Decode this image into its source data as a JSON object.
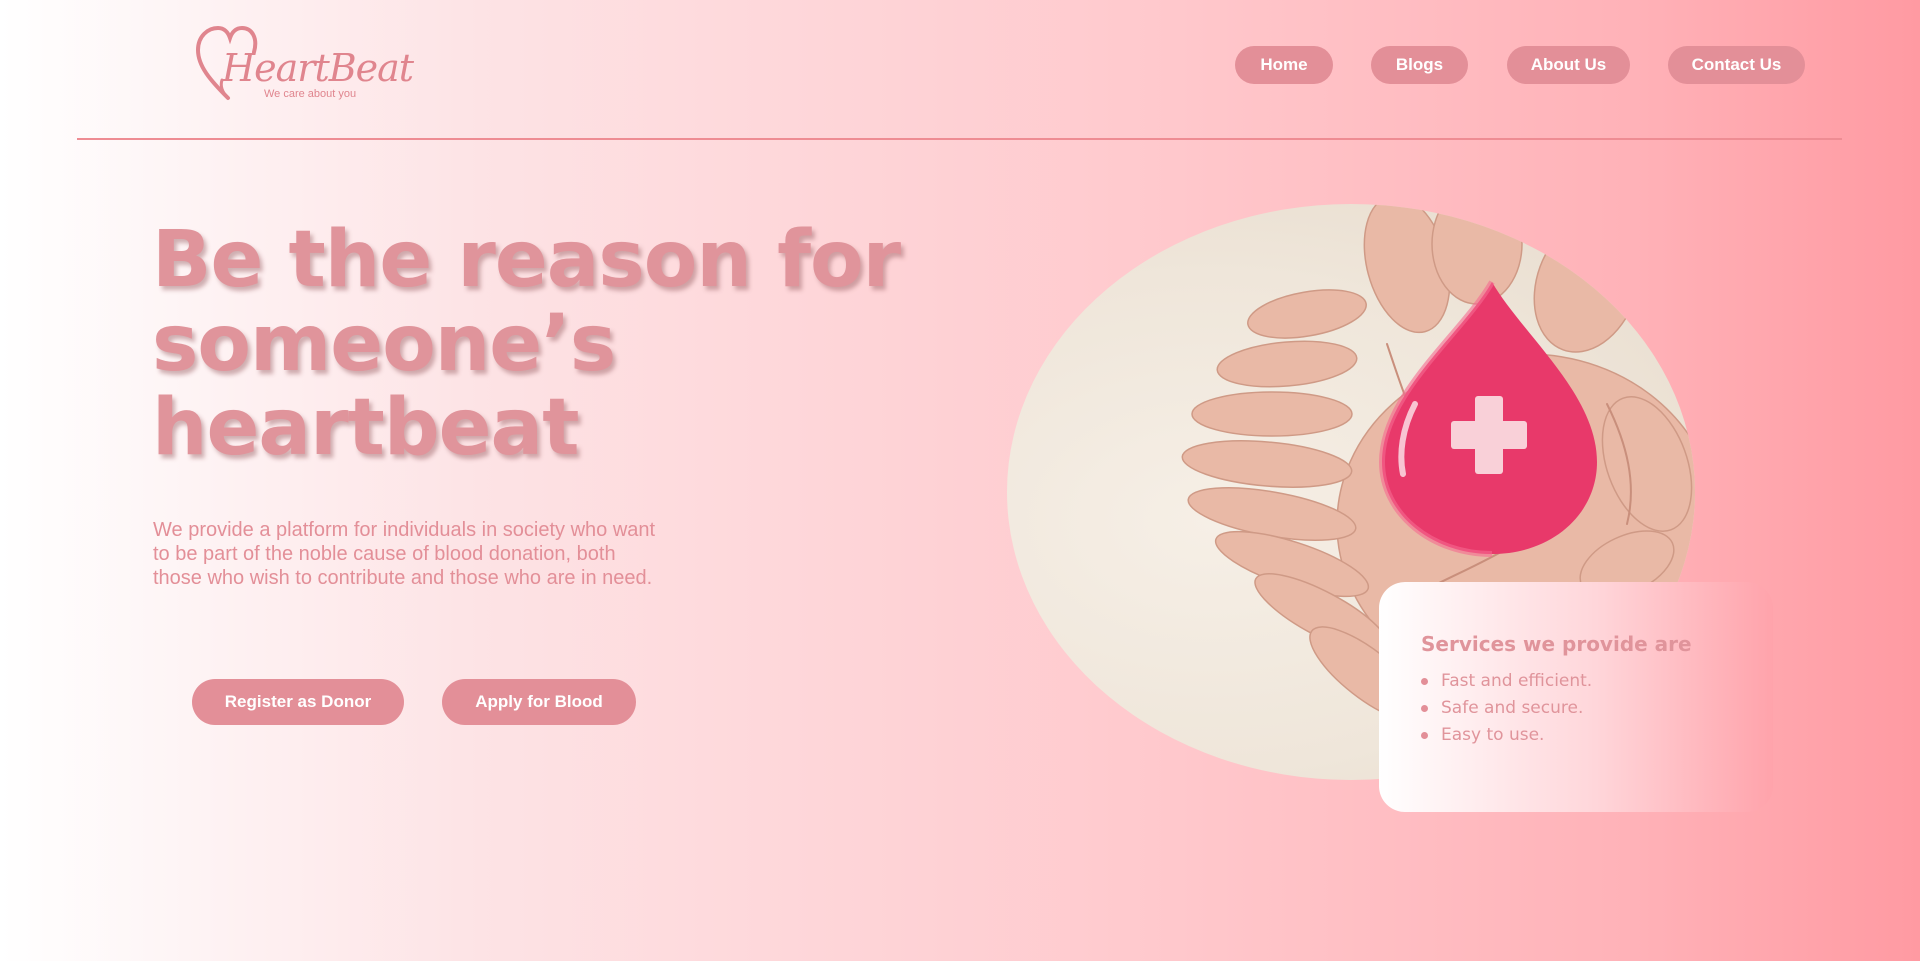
{
  "brand": {
    "name": "HeartBeat",
    "tagline": "We care about you"
  },
  "nav": {
    "home": "Home",
    "blogs": "Blogs",
    "about": "About Us",
    "contact": "Contact Us"
  },
  "hero": {
    "headline_line1": "Be the reason for",
    "headline_line2": "someone’s",
    "headline_line3": "heartbeat",
    "description": "We provide a platform for individuals in society who want to be part of the noble cause of blood donation, both those who wish to contribute and those who are in need.",
    "register_label": "Register as Donor",
    "apply_label": "Apply for Blood"
  },
  "services": {
    "title": "Services we provide are",
    "items": [
      "Fast and efficient.",
      "Safe and secure.",
      "Easy to use."
    ]
  },
  "colors": {
    "accent": "#e38f98",
    "gradient_end": "#ff9aa2",
    "drop": "#e8396a"
  }
}
